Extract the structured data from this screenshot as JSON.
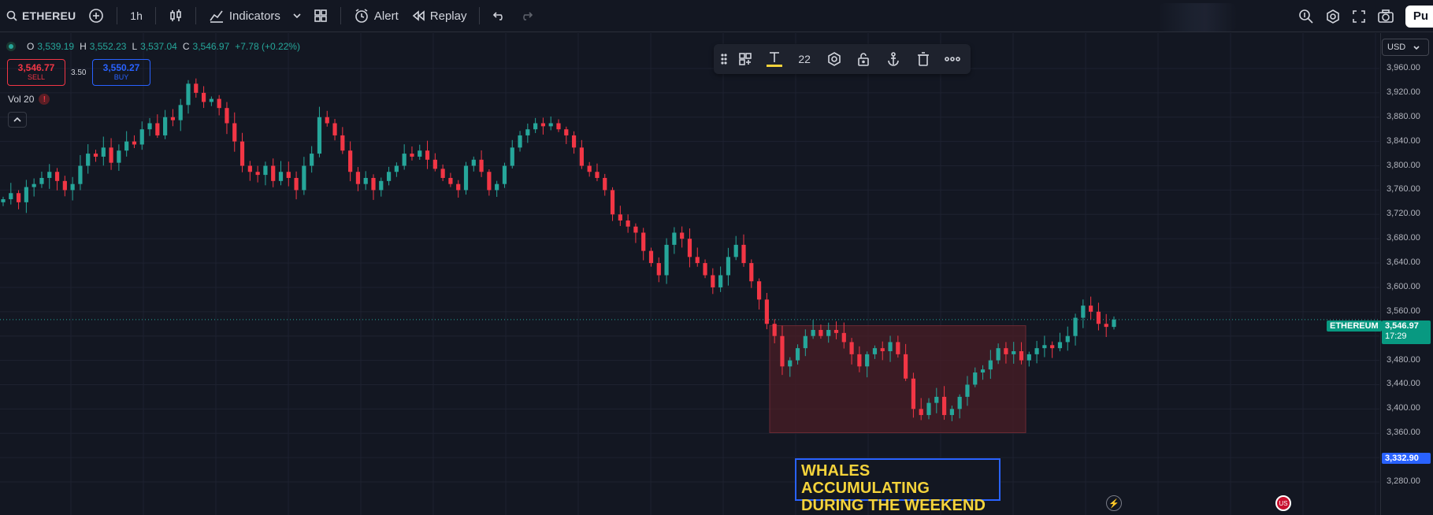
{
  "toolbar": {
    "symbol": "ETHEREU",
    "interval": "1h",
    "indicators_label": "Indicators",
    "alert_label": "Alert",
    "replay_label": "Replay",
    "publish_label": "Pu"
  },
  "legend": {
    "open_key": "O",
    "open": "3,539.19",
    "high_key": "H",
    "high": "3,552.23",
    "low_key": "L",
    "low": "3,537.04",
    "close_key": "C",
    "close": "3,546.97",
    "change": "+7.78 (+0.22%)"
  },
  "trade": {
    "sell_price": "3,546.77",
    "sell_label": "SELL",
    "spread": "3.50",
    "buy_price": "3,550.27",
    "buy_label": "BUY"
  },
  "volume": {
    "label": "Vol 20",
    "warning": "!"
  },
  "drawbar": {
    "font_size": "22"
  },
  "price_axis": {
    "currency": "USD",
    "ticks": [
      "3,960.00",
      "3,920.00",
      "3,880.00",
      "3,840.00",
      "3,800.00",
      "3,760.00",
      "3,720.00",
      "3,680.00",
      "3,640.00",
      "3,600.00",
      "3,560.00",
      "3,480.00",
      "3,440.00",
      "3,400.00",
      "3,360.00",
      "3,280.00"
    ],
    "symbol_tag": "ETHEREUM",
    "last_price": "3,546.97",
    "countdown": "17:29",
    "crosshair_price": "3,332.90"
  },
  "annotation": {
    "line1": "WHALES ACCUMULATING",
    "line2": "DURING THE WEEKEND"
  },
  "colors": {
    "up": "#26a69a",
    "down": "#f23645",
    "background": "#131722",
    "zone": "#4a1d26",
    "text_annotation": "#f5d33b"
  },
  "chart_data": {
    "type": "candlestick",
    "symbol": "ETHEREUM",
    "interval": "1h",
    "ylim": [
      3260,
      3990
    ],
    "last_close": 3546.97,
    "zone": {
      "top": 3537,
      "bottom": 3361
    },
    "closes": [
      3745,
      3755,
      3740,
      3765,
      3770,
      3780,
      3790,
      3775,
      3760,
      3770,
      3800,
      3820,
      3815,
      3830,
      3805,
      3825,
      3840,
      3835,
      3860,
      3870,
      3850,
      3880,
      3875,
      3900,
      3935,
      3920,
      3905,
      3910,
      3895,
      3870,
      3840,
      3800,
      3790,
      3785,
      3800,
      3775,
      3790,
      3780,
      3760,
      3800,
      3820,
      3880,
      3870,
      3850,
      3825,
      3790,
      3770,
      3780,
      3760,
      3775,
      3790,
      3800,
      3820,
      3815,
      3825,
      3810,
      3795,
      3780,
      3770,
      3760,
      3800,
      3810,
      3790,
      3760,
      3770,
      3800,
      3830,
      3850,
      3860,
      3870,
      3865,
      3870,
      3860,
      3850,
      3830,
      3800,
      3790,
      3780,
      3760,
      3720,
      3710,
      3700,
      3690,
      3660,
      3640,
      3620,
      3670,
      3690,
      3680,
      3650,
      3640,
      3620,
      3600,
      3620,
      3650,
      3670,
      3640,
      3610,
      3580,
      3540,
      3520,
      3470,
      3480,
      3500,
      3520,
      3530,
      3520,
      3530,
      3525,
      3510,
      3490,
      3470,
      3490,
      3500,
      3495,
      3510,
      3490,
      3450,
      3400,
      3390,
      3410,
      3420,
      3390,
      3400,
      3420,
      3440,
      3460,
      3465,
      3480,
      3500,
      3490,
      3495,
      3480,
      3490,
      3500,
      3505,
      3500,
      3510,
      3520,
      3550,
      3570,
      3560,
      3540,
      3535,
      3547
    ]
  }
}
